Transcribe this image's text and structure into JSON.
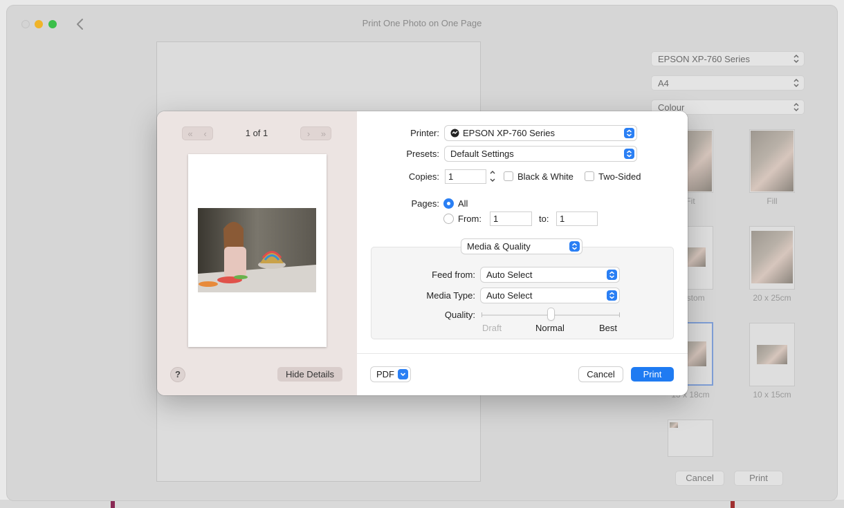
{
  "window": {
    "title": "Print One Photo on One Page"
  },
  "background_panel": {
    "printer": "EPSON XP-760 Series",
    "paper_size": "A4",
    "color_mode": "Colour",
    "layouts": [
      {
        "label": "Fit"
      },
      {
        "label": "Fill"
      },
      {
        "label": "Custom"
      },
      {
        "label": "20 x 25cm"
      },
      {
        "label": "13 x 18cm"
      },
      {
        "label": "10 x 15cm"
      },
      {
        "label": ""
      }
    ],
    "cancel_label": "Cancel",
    "print_label": "Print"
  },
  "dialog": {
    "preview": {
      "page_counter": "1 of 1",
      "first_label": "«",
      "prev_label": "‹",
      "next_label": "›",
      "last_label": "»",
      "help_label": "?",
      "hide_details_label": "Hide Details"
    },
    "printer": {
      "label": "Printer:",
      "value": "EPSON XP-760 Series"
    },
    "presets": {
      "label": "Presets:",
      "value": "Default Settings"
    },
    "copies": {
      "label": "Copies:",
      "value": "1"
    },
    "black_white": {
      "label": "Black & White",
      "checked": false
    },
    "two_sided": {
      "label": "Two-Sided",
      "checked": false
    },
    "pages": {
      "label": "Pages:",
      "all_label": "All",
      "all_selected": true,
      "from_label": "From:",
      "from_value": "1",
      "to_label": "to:",
      "to_value": "1"
    },
    "section": {
      "value": "Media & Quality"
    },
    "feed_from": {
      "label": "Feed from:",
      "value": "Auto Select"
    },
    "media_type": {
      "label": "Media Type:",
      "value": "Auto Select"
    },
    "quality": {
      "label": "Quality:",
      "draft_label": "Draft",
      "normal_label": "Normal",
      "best_label": "Best",
      "level": "Normal"
    },
    "pdf_label": "PDF",
    "cancel_label": "Cancel",
    "print_label": "Print"
  },
  "colors": {
    "accent": "#1f7bf2",
    "preview_bg": "#ece4e2"
  }
}
